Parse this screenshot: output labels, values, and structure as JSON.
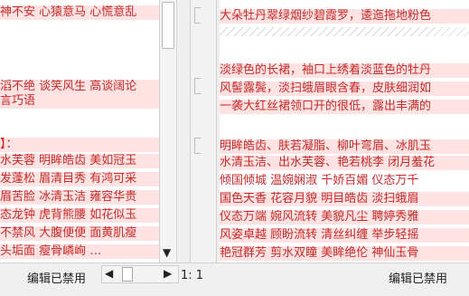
{
  "left": {
    "lines": [
      "神不安  心猿意马  心慌意乱",
      "滔不绝  谈笑风生  高谈阔论",
      "言巧语",
      "】：",
      "水芙蓉  明眸皓齿  美如冠玉",
      "发蓬松  眉清目秀  有鸿可采",
      "眉苦脸  冰清玉洁  雍容华贵",
      "态龙钟  虎背熊腰  如花似玉",
      "不禁风  大腹便便  面黄肌瘦",
      "头垢面  瘦骨嶙峋  …"
    ]
  },
  "right": {
    "lines": [
      "大朵牡丹翠绿烟纱碧霞罗，逶迤拖地粉色",
      "淡绿色的长裙，袖口上绣着淡蓝色的牡丹",
      "风髻露鬓，淡扫蛾眉眼含春，皮肤细润如",
      "一袭大红丝裙领口开的很低，露出丰满的",
      "明眸皓齿、肤若凝脂、柳叶弯眉、冰肌玉",
      "水清玉洁、出水芙蓉、艳若桃李  闭月羞花",
      "倾国倾城  温婉娴淑  千娇百媚  仪态万千",
      "国色天香  花容月貌  明目皓齿  淡扫蛾眉",
      "仪态万端  婉风流转  美貌凡尘  聘婷秀雅",
      "风姿卓越  顾盼流转  清丝纠缠  举步轻摇",
      "艳冠群芳  剪水双瞳  美眸绝伦  神仙玉骨"
    ]
  },
  "status": {
    "left_mode": "编辑已禁用",
    "position": "1: 1",
    "right_mode": "编辑已禁用"
  },
  "scroll": {
    "left_vertical": 0.0,
    "left_horizontal": 0.1
  },
  "icons": {
    "left_arrow": "◀",
    "right_arrow": "▶",
    "up_arrow": "▲",
    "down_arrow": "▼"
  }
}
